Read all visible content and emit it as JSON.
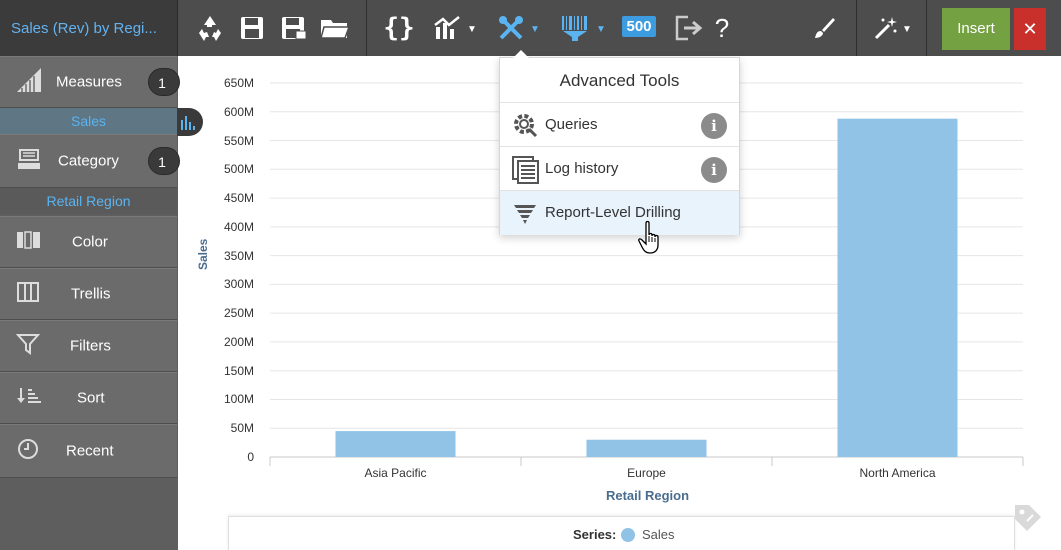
{
  "toolbar": {
    "title": "Sales (Rev) by Regi...",
    "badge_value": "500",
    "insert_label": "Insert",
    "close_label": "✕",
    "help_label": "?"
  },
  "sidebar": {
    "measures": {
      "label": "Measures",
      "count": "1",
      "selected": "Sales"
    },
    "category": {
      "label": "Category",
      "count": "1",
      "selected": "Retail Region"
    },
    "items": [
      {
        "label": "Color"
      },
      {
        "label": "Trellis"
      },
      {
        "label": "Filters"
      },
      {
        "label": "Sort"
      },
      {
        "label": "Recent"
      }
    ]
  },
  "dropdown": {
    "title": "Advanced Tools",
    "items": [
      {
        "label": "Queries",
        "info": "i"
      },
      {
        "label": "Log history",
        "info": "i"
      },
      {
        "label": "Report-Level Drilling"
      }
    ]
  },
  "legend": {
    "series_label": "Series:",
    "series_name": "Sales"
  },
  "colors": {
    "bar": "#90c3e6",
    "accent": "#5ab4f2",
    "insert": "#74a142",
    "close": "#c9302c"
  },
  "chart_data": {
    "type": "bar",
    "categories": [
      "Asia Pacific",
      "Europe",
      "North America"
    ],
    "series": [
      {
        "name": "Sales",
        "values": [
          45000000,
          30000000,
          588000000
        ]
      }
    ],
    "xlabel": "Retail Region",
    "ylabel": "Sales",
    "ylim": [
      0,
      650000000
    ],
    "yticks": [
      "0",
      "50M",
      "100M",
      "150M",
      "200M",
      "250M",
      "300M",
      "350M",
      "400M",
      "450M",
      "500M",
      "550M",
      "600M",
      "650M"
    ],
    "grid": true,
    "legend": "bottom"
  }
}
